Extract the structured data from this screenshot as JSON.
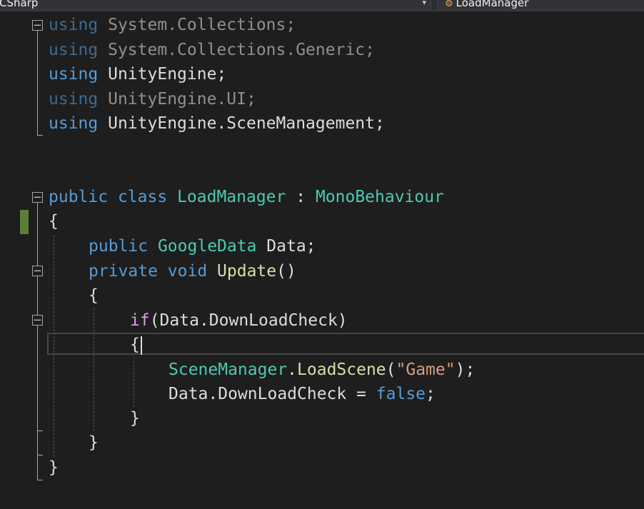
{
  "navbar": {
    "project_dropdown": "CSharp",
    "type_dropdown": "LoadManager",
    "type_icon": "class-icon",
    "arrow_icon": "chevron-down-icon"
  },
  "colors": {
    "background": "#1e1e1e",
    "keyword": "#569cd6",
    "control_keyword": "#d8a0df",
    "type": "#4ec9b0",
    "method": "#dcdcaa",
    "string": "#d69d85",
    "text": "#dcdcdc",
    "unused_using": "#909090",
    "change_marker": "#5b7e3a"
  },
  "fold_glyph": "−",
  "code": {
    "using": "using",
    "ns_collections": "System.Collections;",
    "ns_generic": "System.Collections.Generic;",
    "ns_unity": "UnityEngine;",
    "ns_ui": "UnityEngine.UI;",
    "ns_scene": "UnityEngine.SceneManagement;",
    "public": "public",
    "class": "class",
    "class_name": "LoadManager",
    "colon": " : ",
    "base_type": "MonoBehaviour",
    "open_brace": "{",
    "close_brace": "}",
    "field_type": "GoogleData",
    "field_name": " Data;",
    "private": "private",
    "void": "void",
    "method_name": "Update",
    "parens": "()",
    "if": "if",
    "condition": "(Data.DownLoadCheck)",
    "scene_manager": "SceneManager",
    "dot": ".",
    "load_scene": "LoadScene",
    "open_paren": "(",
    "game_string": "\"Game\"",
    "close_call": ");",
    "assign_target": "Data.DownLoadCheck = ",
    "false": "false",
    "semicolon": ";"
  }
}
